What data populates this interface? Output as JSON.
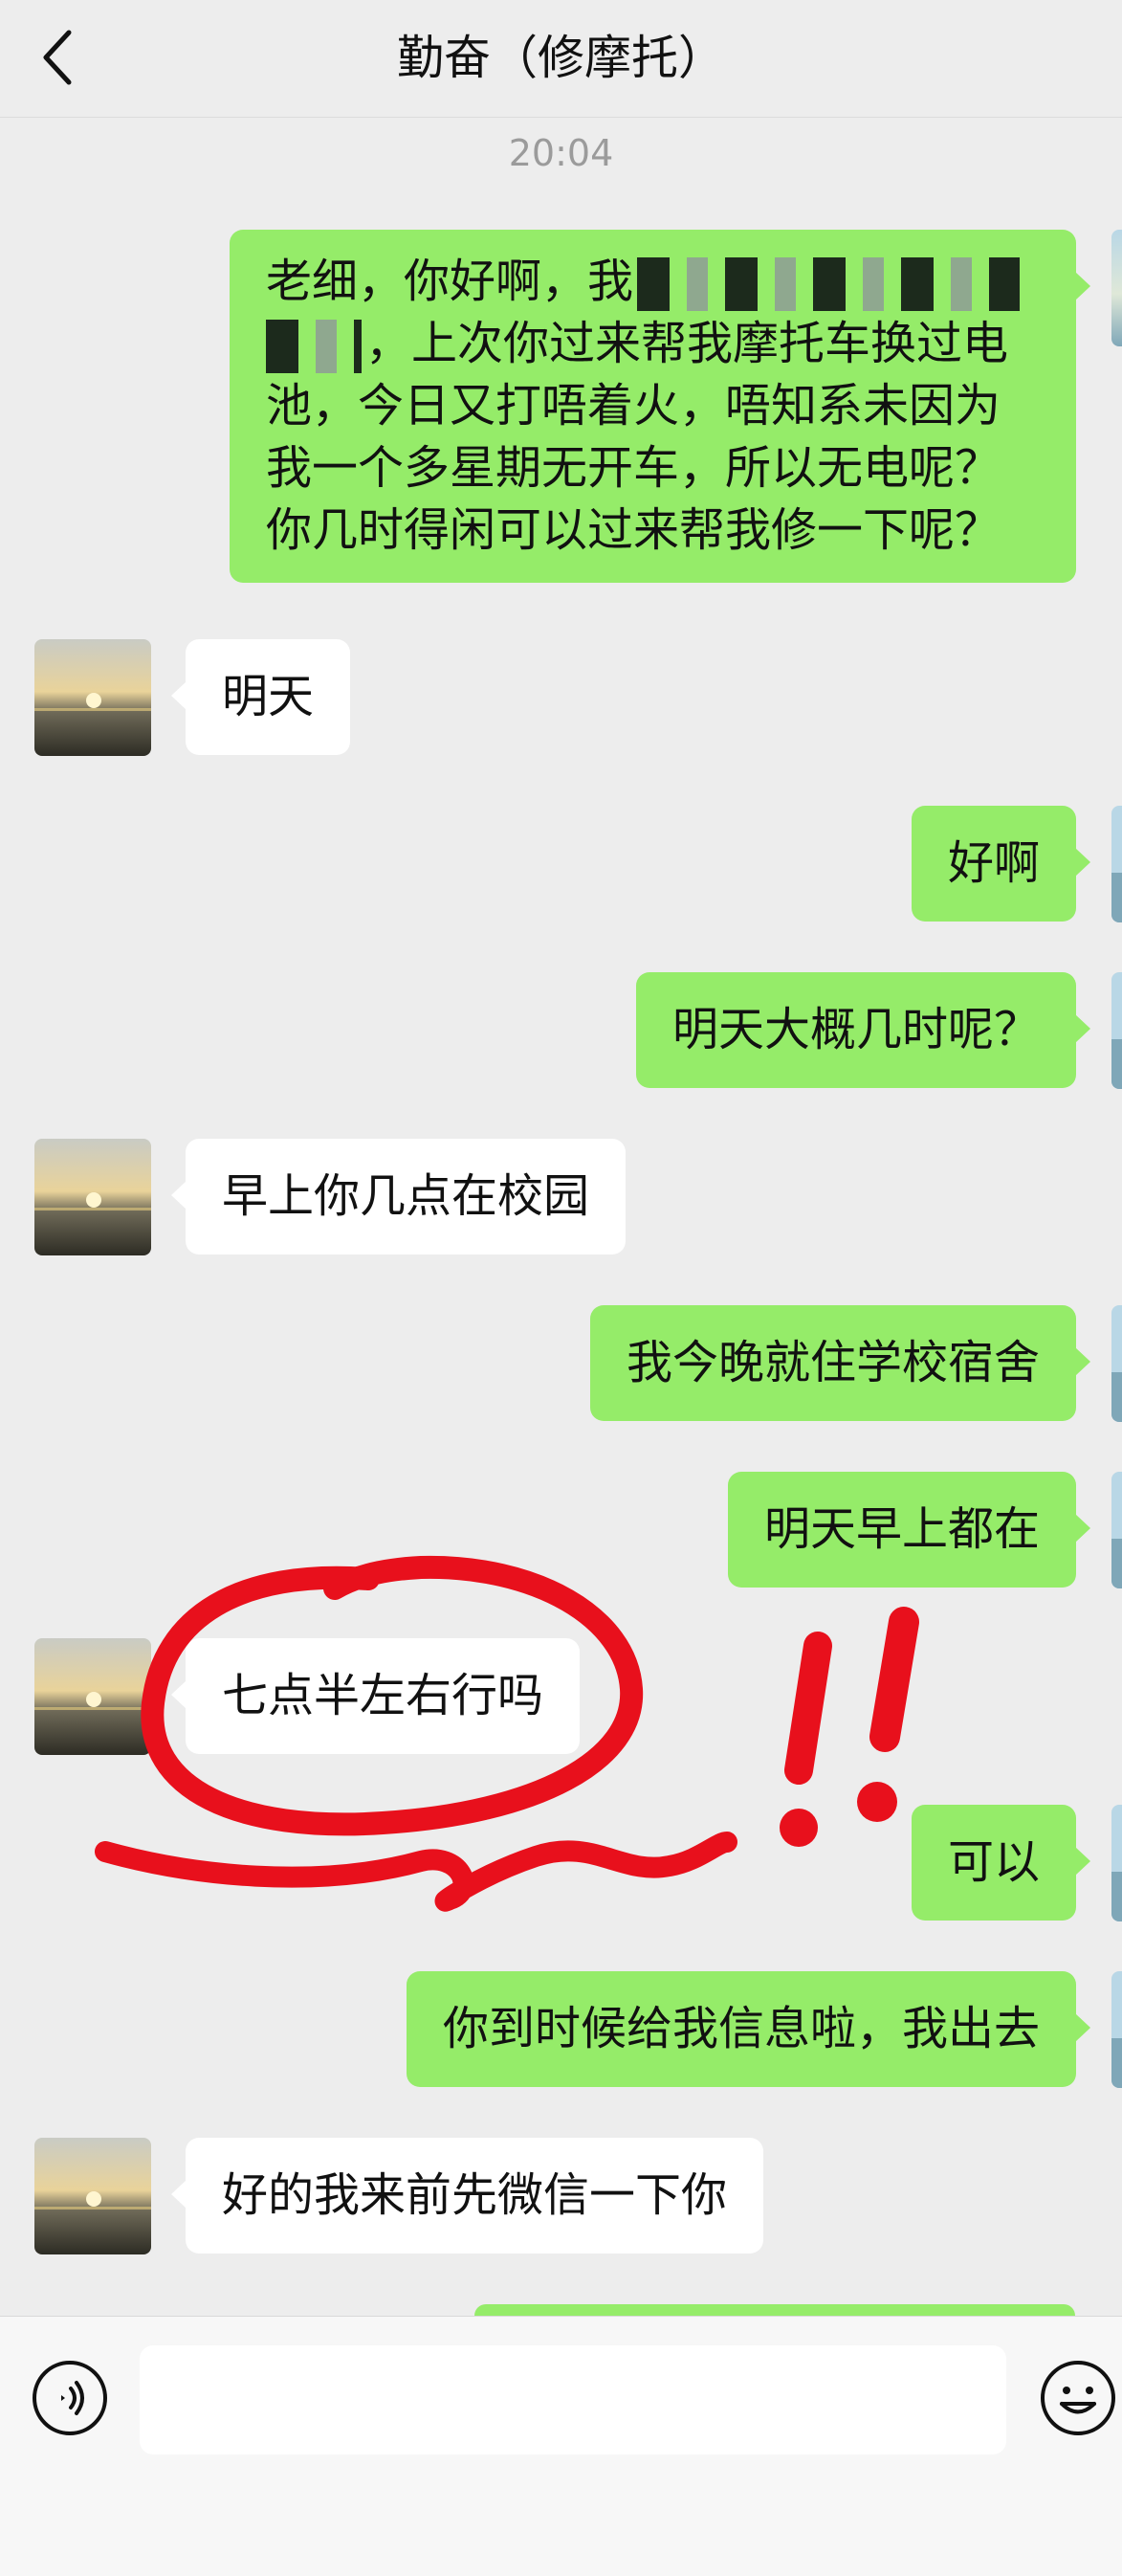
{
  "header": {
    "title": "勤奋（修摩托）"
  },
  "chat": {
    "timestamp": "20:04",
    "messages": [
      {
        "side": "out",
        "lines": [
          "老细，你好啊，我",
          "，上次你过来帮我摩托车换过电",
          "池，今日又打唔着火，唔知系未因为",
          "我一个多星期无开车，所以无电呢？",
          "你几时得闲可以过来帮我修一下呢？"
        ]
      },
      {
        "side": "in",
        "text": "明天"
      },
      {
        "side": "out",
        "text": "好啊"
      },
      {
        "side": "out",
        "text": "明天大概几时呢？"
      },
      {
        "side": "in",
        "text": "早上你几点在校园"
      },
      {
        "side": "out",
        "text": "我今晚就住学校宿舍"
      },
      {
        "side": "out",
        "text": "明天早上都在"
      },
      {
        "side": "in",
        "text": "七点半左右行吗"
      },
      {
        "side": "out",
        "text": "可以"
      },
      {
        "side": "out",
        "text": "你到时候给我信息啦，我出去"
      },
      {
        "side": "in",
        "text": "好的我来前先微信一下你"
      }
    ]
  },
  "colors": {
    "outgoing_bubble": "#95ec69",
    "incoming_bubble": "#ffffff",
    "background": "#ededed",
    "annotation_ink": "#e8101c"
  },
  "icons": {
    "back": "chevron-left-icon",
    "voice": "voice-icon",
    "emoji": "emoji-icon"
  }
}
